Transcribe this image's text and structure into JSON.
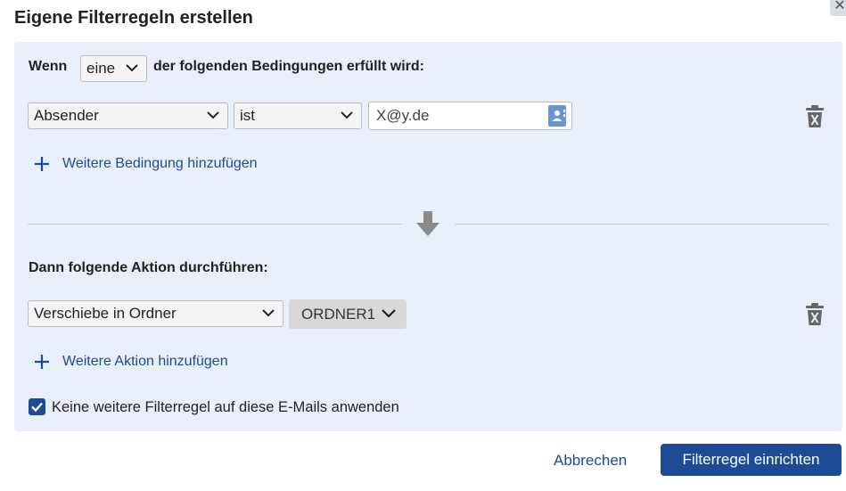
{
  "dialog": {
    "title": "Eigene Filterregeln erstellen",
    "close_label": "✕"
  },
  "conditions": {
    "prefix": "Wenn",
    "match_select": "eine",
    "suffix": "der folgenden Bedingungen erfüllt wird:",
    "rows": [
      {
        "field": "Absender",
        "operator": "ist",
        "value": "X@y.de"
      }
    ],
    "add_label": "Weitere Bedingung hinzufügen"
  },
  "actions": {
    "heading": "Dann folgende Aktion durchführen:",
    "rows": [
      {
        "action": "Verschiebe in Ordner",
        "folder": "ORDNER1"
      }
    ],
    "add_label": "Weitere Aktion hinzufügen"
  },
  "stop_rule": {
    "checked": true,
    "label": "Keine weitere Filterregel auf diese E-Mails anwenden"
  },
  "footer": {
    "cancel_label": "Abbrechen",
    "submit_label": "Filterregel einrichten"
  },
  "colors": {
    "accent": "#1d4b96",
    "panel": "#e9eff8",
    "address_book_icon": "#6b95d0"
  }
}
